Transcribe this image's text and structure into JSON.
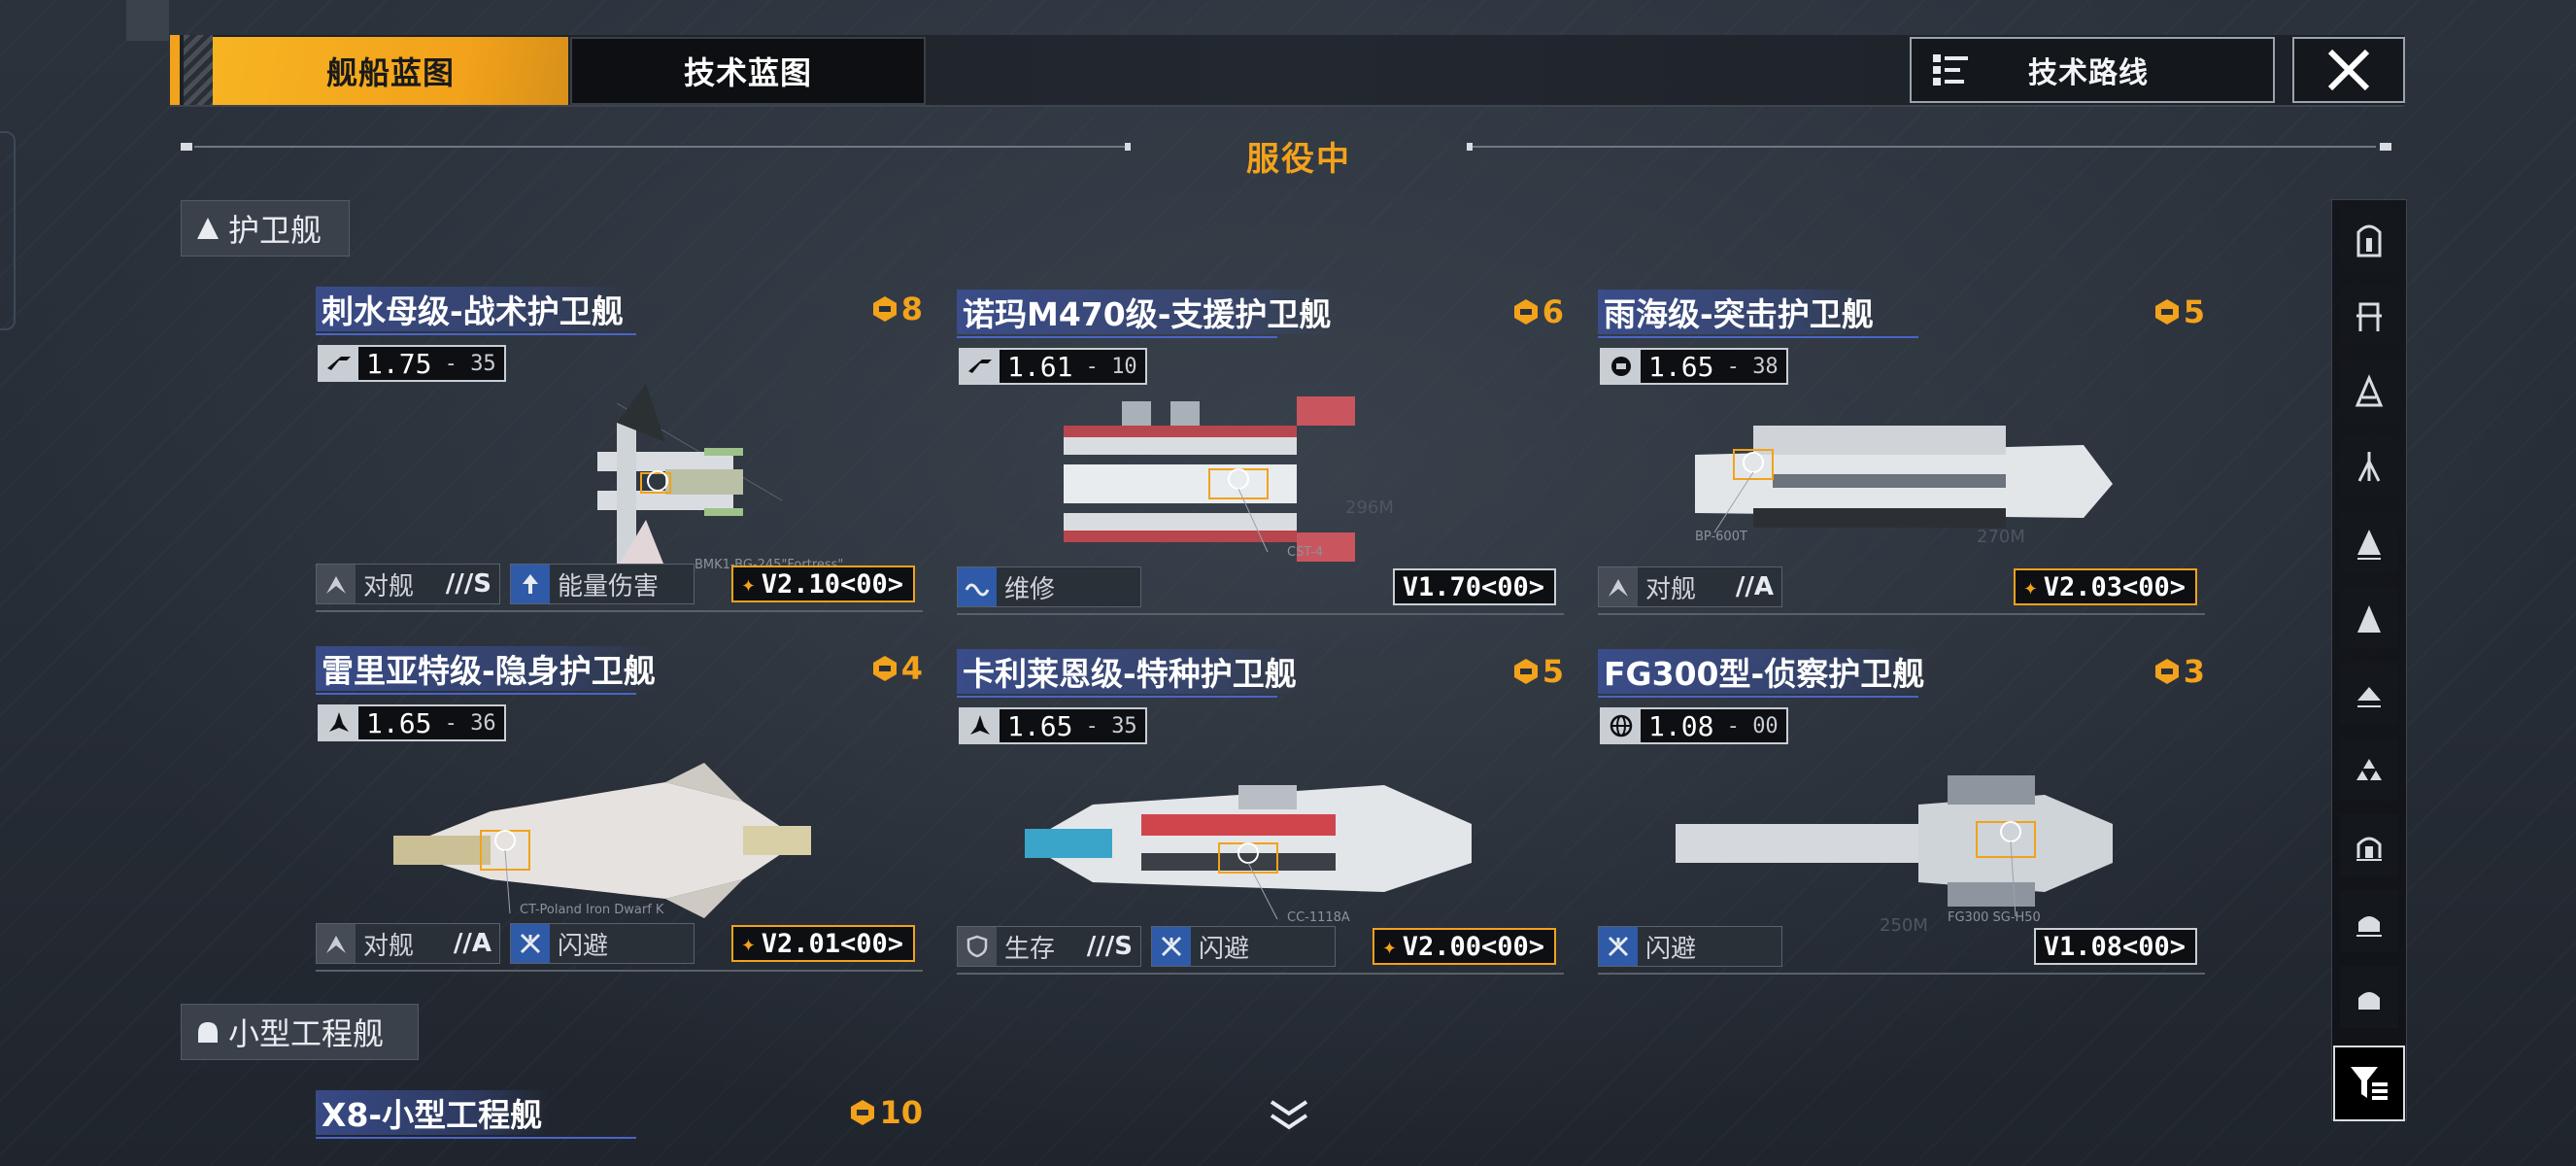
{
  "tabs": {
    "active": "舰船蓝图",
    "inactive": "技术蓝图"
  },
  "route_button": "技术路线",
  "status": "服役中",
  "categories": [
    {
      "label": "护卫舰"
    },
    {
      "label": "小型工程舰"
    }
  ],
  "ships": [
    {
      "title": "刺水母级-战术护卫舰",
      "rank": "8",
      "stat_main": "1.75",
      "stat_sub": "35",
      "stat_icon": "speed-icon",
      "skill1": "对舰",
      "skill1_grade": "///S",
      "skill2": "能量伤害",
      "version": "V2.10<00>",
      "version_star": true,
      "tag": "BMK1-BG-245\"Fortress\""
    },
    {
      "title": "诺玛M470级-支援护卫舰",
      "rank": "6",
      "stat_main": "1.61",
      "stat_sub": "10",
      "stat_icon": "speed-icon",
      "skill1": "维修",
      "skill1_grade": "",
      "skill2": "",
      "version": "V1.70<00>",
      "version_star": false,
      "tag": "CST-4",
      "size": "296M"
    },
    {
      "title": "雨海级-突击护卫舰",
      "rank": "5",
      "stat_main": "1.65",
      "stat_sub": "38",
      "stat_icon": "fire-icon",
      "skill1": "对舰",
      "skill1_grade": "//A",
      "skill2": "",
      "version": "V2.03<00>",
      "version_star": true,
      "tag": "BP-600T",
      "size": "270M"
    },
    {
      "title": "雷里亚特级-隐身护卫舰",
      "rank": "4",
      "stat_main": "1.65",
      "stat_sub": "36",
      "stat_icon": "fighter-icon",
      "skill1": "对舰",
      "skill1_grade": "//A",
      "skill2": "闪避",
      "version": "V2.01<00>",
      "version_star": true,
      "tag": "CT-Poland Iron Dwarf K"
    },
    {
      "title": "卡利莱恩级-特种护卫舰",
      "rank": "5",
      "stat_main": "1.65",
      "stat_sub": "35",
      "stat_icon": "fighter-icon",
      "skill1": "生存",
      "skill1_grade": "///S",
      "skill2": "闪避",
      "version": "V2.00<00>",
      "version_star": true,
      "tag": "CC-1118A"
    },
    {
      "title": "FG300型-侦察护卫舰",
      "rank": "3",
      "stat_main": "1.08",
      "stat_sub": "00",
      "stat_icon": "globe-icon",
      "skill1": "闪避",
      "skill1_grade": "",
      "skill2": "",
      "version": "V1.08<00>",
      "version_star": false,
      "tag": "FG300 SG-H50",
      "size": "250M"
    },
    {
      "title": "X8-小型工程舰",
      "rank": "10"
    }
  ],
  "colors": {
    "accent": "#f2a21b",
    "title_band": "#3c5096",
    "background": "#2a3039"
  }
}
